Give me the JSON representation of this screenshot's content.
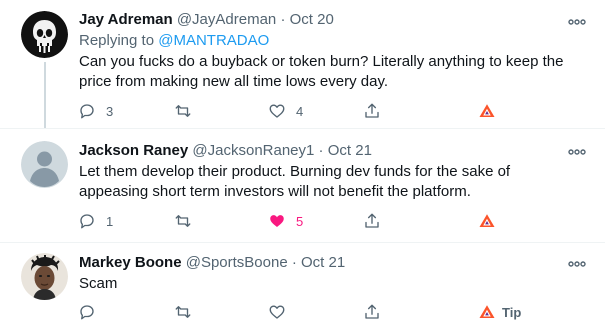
{
  "tweets": [
    {
      "name": "Jay Adreman",
      "handle": "@JayAdreman",
      "separator": "·",
      "date": "Oct 20",
      "replying_prefix": "Replying to",
      "replying_to": "@MANTRADAO",
      "text": "Can you fucks do a buyback or token burn? Literally anything to keep the price from making new all time lows every day.",
      "reply_count": "3",
      "retweet_count": "",
      "like_count": "4",
      "liked": false,
      "tip_label": ""
    },
    {
      "name": "Jackson Raney",
      "handle": "@JacksonRaney1",
      "separator": "·",
      "date": "Oct 21",
      "text": "Let them develop their product. Burning dev funds for the sake of appeasing short term investors will not benefit the platform.",
      "reply_count": "1",
      "retweet_count": "",
      "like_count": "5",
      "liked": true,
      "tip_label": ""
    },
    {
      "name": "Markey Boone",
      "handle": "@SportsBoone",
      "separator": "·",
      "date": "Oct 21",
      "text": "Scam",
      "reply_count": "",
      "retweet_count": "",
      "like_count": "",
      "liked": false,
      "tip_label": "Tip"
    }
  ],
  "colors": {
    "accent": "#1d9bf0",
    "like": "#f91880",
    "brave": "#fb542b",
    "muted": "#536471"
  }
}
